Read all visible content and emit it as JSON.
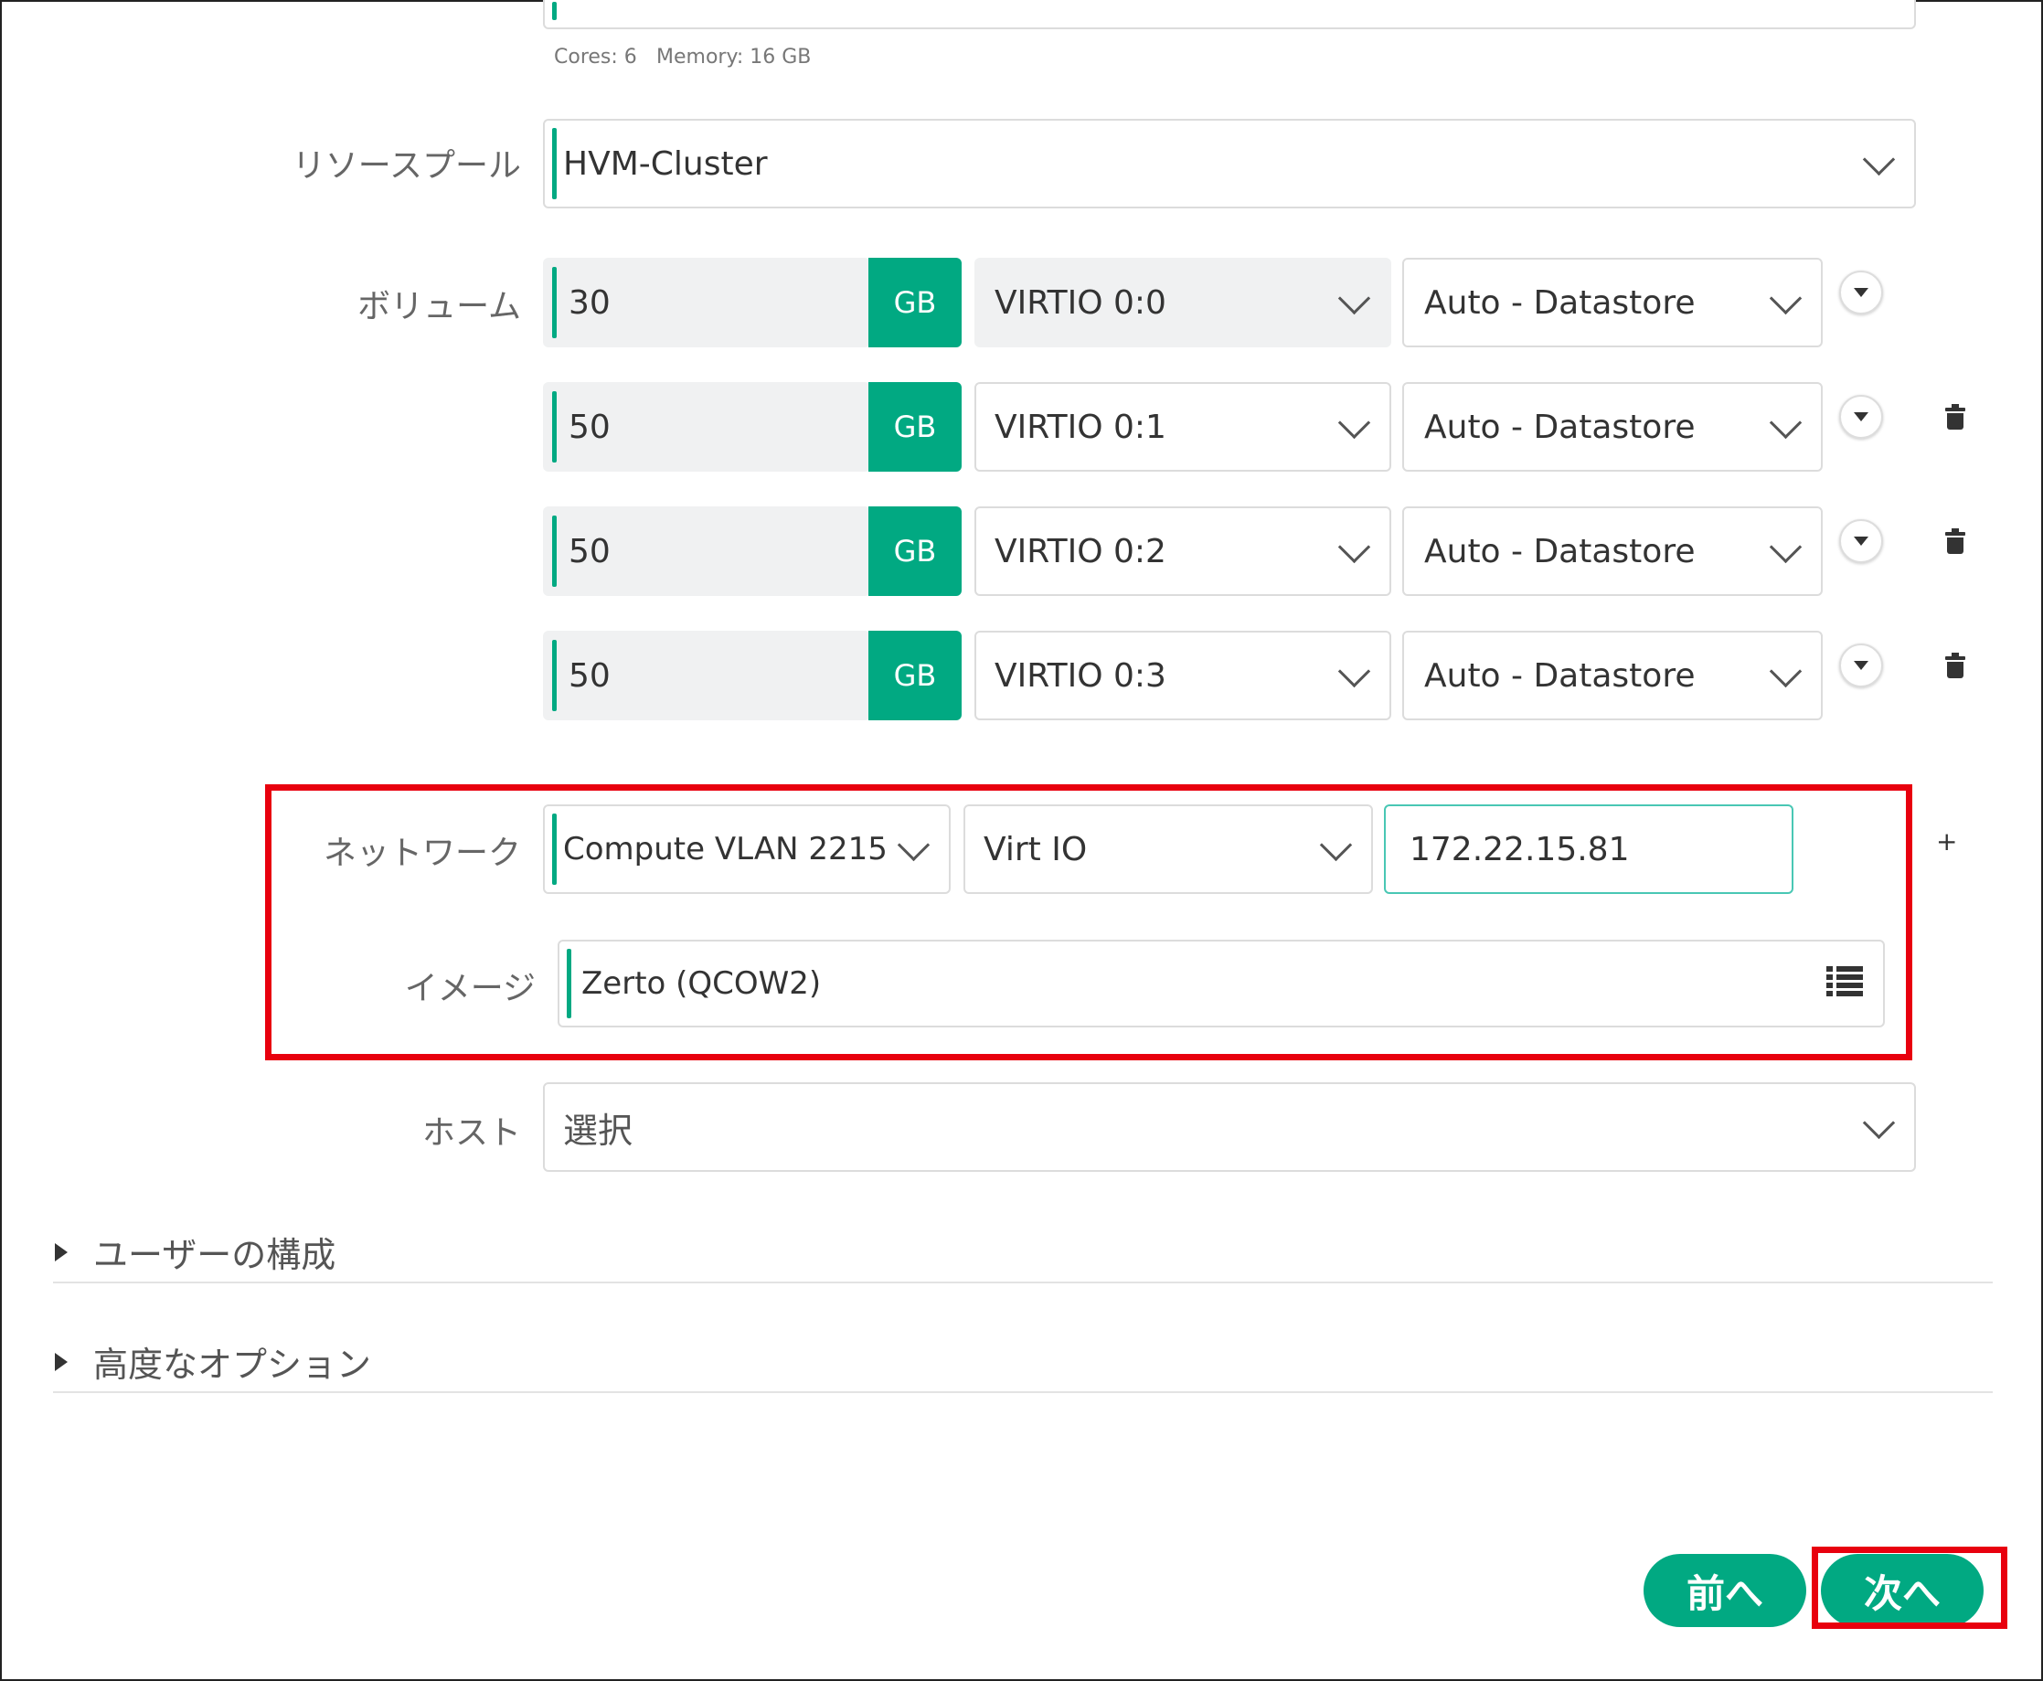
{
  "hint": {
    "cores": "Cores: 6",
    "memory": "Memory: 16 GB"
  },
  "resource_pool": {
    "label": "リソースプール",
    "value": "HVM-Cluster"
  },
  "volumes": {
    "label": "ボリューム",
    "rows": [
      {
        "size": "30",
        "unit": "GB",
        "controller": "VIRTIO 0:0",
        "datastore": "Auto - Datastore"
      },
      {
        "size": "50",
        "unit": "GB",
        "controller": "VIRTIO 0:1",
        "datastore": "Auto - Datastore"
      },
      {
        "size": "50",
        "unit": "GB",
        "controller": "VIRTIO 0:2",
        "datastore": "Auto - Datastore"
      },
      {
        "size": "50",
        "unit": "GB",
        "controller": "VIRTIO 0:3",
        "datastore": "Auto - Datastore"
      }
    ]
  },
  "network": {
    "label": "ネットワーク",
    "network_value": "Compute VLAN 2215",
    "adapter_value": "Virt IO",
    "ip_value": "172.22.15.81",
    "add_symbol": "+"
  },
  "image": {
    "label": "イメージ",
    "value": "Zerto (QCOW2)"
  },
  "host": {
    "label": "ホスト",
    "placeholder": "選択"
  },
  "sections": {
    "user_config": "ユーザーの構成",
    "advanced_options": "高度なオプション"
  },
  "footer": {
    "prev_label": "前へ",
    "next_label": "次へ"
  },
  "colors": {
    "accent": "#01a982",
    "highlight": "#e8000e"
  }
}
